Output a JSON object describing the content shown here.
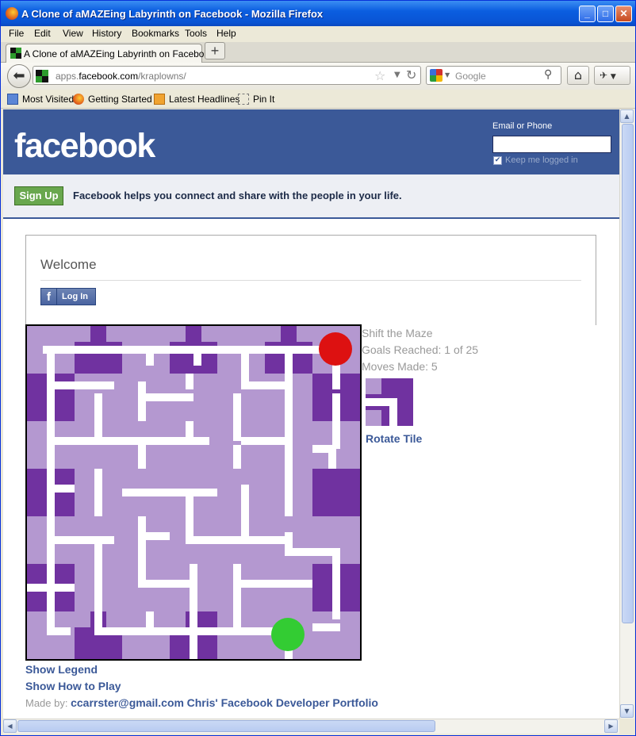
{
  "window": {
    "title": "A Clone of aMAZEing Labyrinth on Facebook - Mozilla Firefox",
    "controls": {
      "minimize": "_",
      "maximize": "□",
      "close": "✕"
    }
  },
  "menu": [
    "File",
    "Edit",
    "View",
    "History",
    "Bookmarks",
    "Tools",
    "Help"
  ],
  "tab": {
    "title": "A Clone of aMAZEing Labyrinth on Facebook",
    "new_tab": "+"
  },
  "address": {
    "prefix": "apps.",
    "domain": "facebook.com",
    "path": "/kraplowns/"
  },
  "search": {
    "placeholder": "Google"
  },
  "bookmarks": [
    "Most Visited",
    "Getting Started",
    "Latest Headlines",
    "Pin It"
  ],
  "facebook": {
    "logo": "facebook",
    "email_label": "Email or Phone",
    "email_value": "",
    "keep_logged_in": "Keep me logged in",
    "signup": "Sign Up",
    "tagline": "Facebook helps you connect and share with the people in your life.",
    "welcome": "Welcome",
    "login": "Log In",
    "login_icon": "f"
  },
  "game": {
    "status_title": "Shift the Maze",
    "goals": "Goals Reached: 1 of 25",
    "moves": "Moves Made: 5",
    "rotate": "Rotate Tile",
    "show_legend": "Show Legend",
    "show_how": "Show How to Play",
    "made_by_label": "Made by:",
    "email": "ccarrster@gmail.com",
    "portfolio": "Chris' Facebook Developer Portfolio",
    "colors": {
      "board": "#b498d0",
      "fixed_tile": "#7032a0",
      "path": "#ffffff",
      "goal": "#dd1111",
      "player": "#33cc33"
    }
  }
}
